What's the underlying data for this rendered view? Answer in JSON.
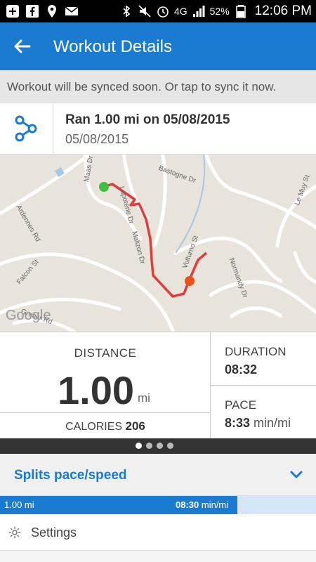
{
  "status_bar": {
    "battery": "52%",
    "time": "12:06 PM",
    "network": "4G"
  },
  "app_bar": {
    "title": "Workout Details"
  },
  "sync_banner": {
    "text": "Workout will be synced soon. Or tap to sync it now."
  },
  "workout": {
    "title": "Ran 1.00 mi on 05/08/2015",
    "date": "05/08/2015"
  },
  "map": {
    "streets": [
      "Maas Dr",
      "Lapoterie Dr",
      "Bastogne Dr",
      "Ardennes Rd",
      "Malizon Dr",
      "Volturno St",
      "Le Muy St",
      "Falcon St",
      "Normandy Dr",
      "Gruber Rd"
    ],
    "attribution": "Google",
    "start_color": "#3fbf3f",
    "end_color": "#e8501e",
    "route_color": "#e03c3c"
  },
  "stats": {
    "distance_label": "DISTANCE",
    "distance_value": "1.00",
    "distance_unit": "mi",
    "calories_label": "CALORIES",
    "calories_value": "206",
    "duration_label": "DURATION",
    "duration_value": "08:32",
    "pace_label": "PACE",
    "pace_value": "8:33",
    "pace_unit": "min/mi"
  },
  "pager": {
    "page_count": 4,
    "active_index": 0
  },
  "splits": {
    "title": "Splits pace/speed",
    "rows": [
      {
        "distance": "1.00 mi",
        "pace": "08:30",
        "unit": "min/mi",
        "fill_fraction": 0.75
      }
    ]
  },
  "settings": {
    "label": "Settings"
  },
  "colors": {
    "accent": "#1a7bd1",
    "status_bar": "#000000"
  }
}
